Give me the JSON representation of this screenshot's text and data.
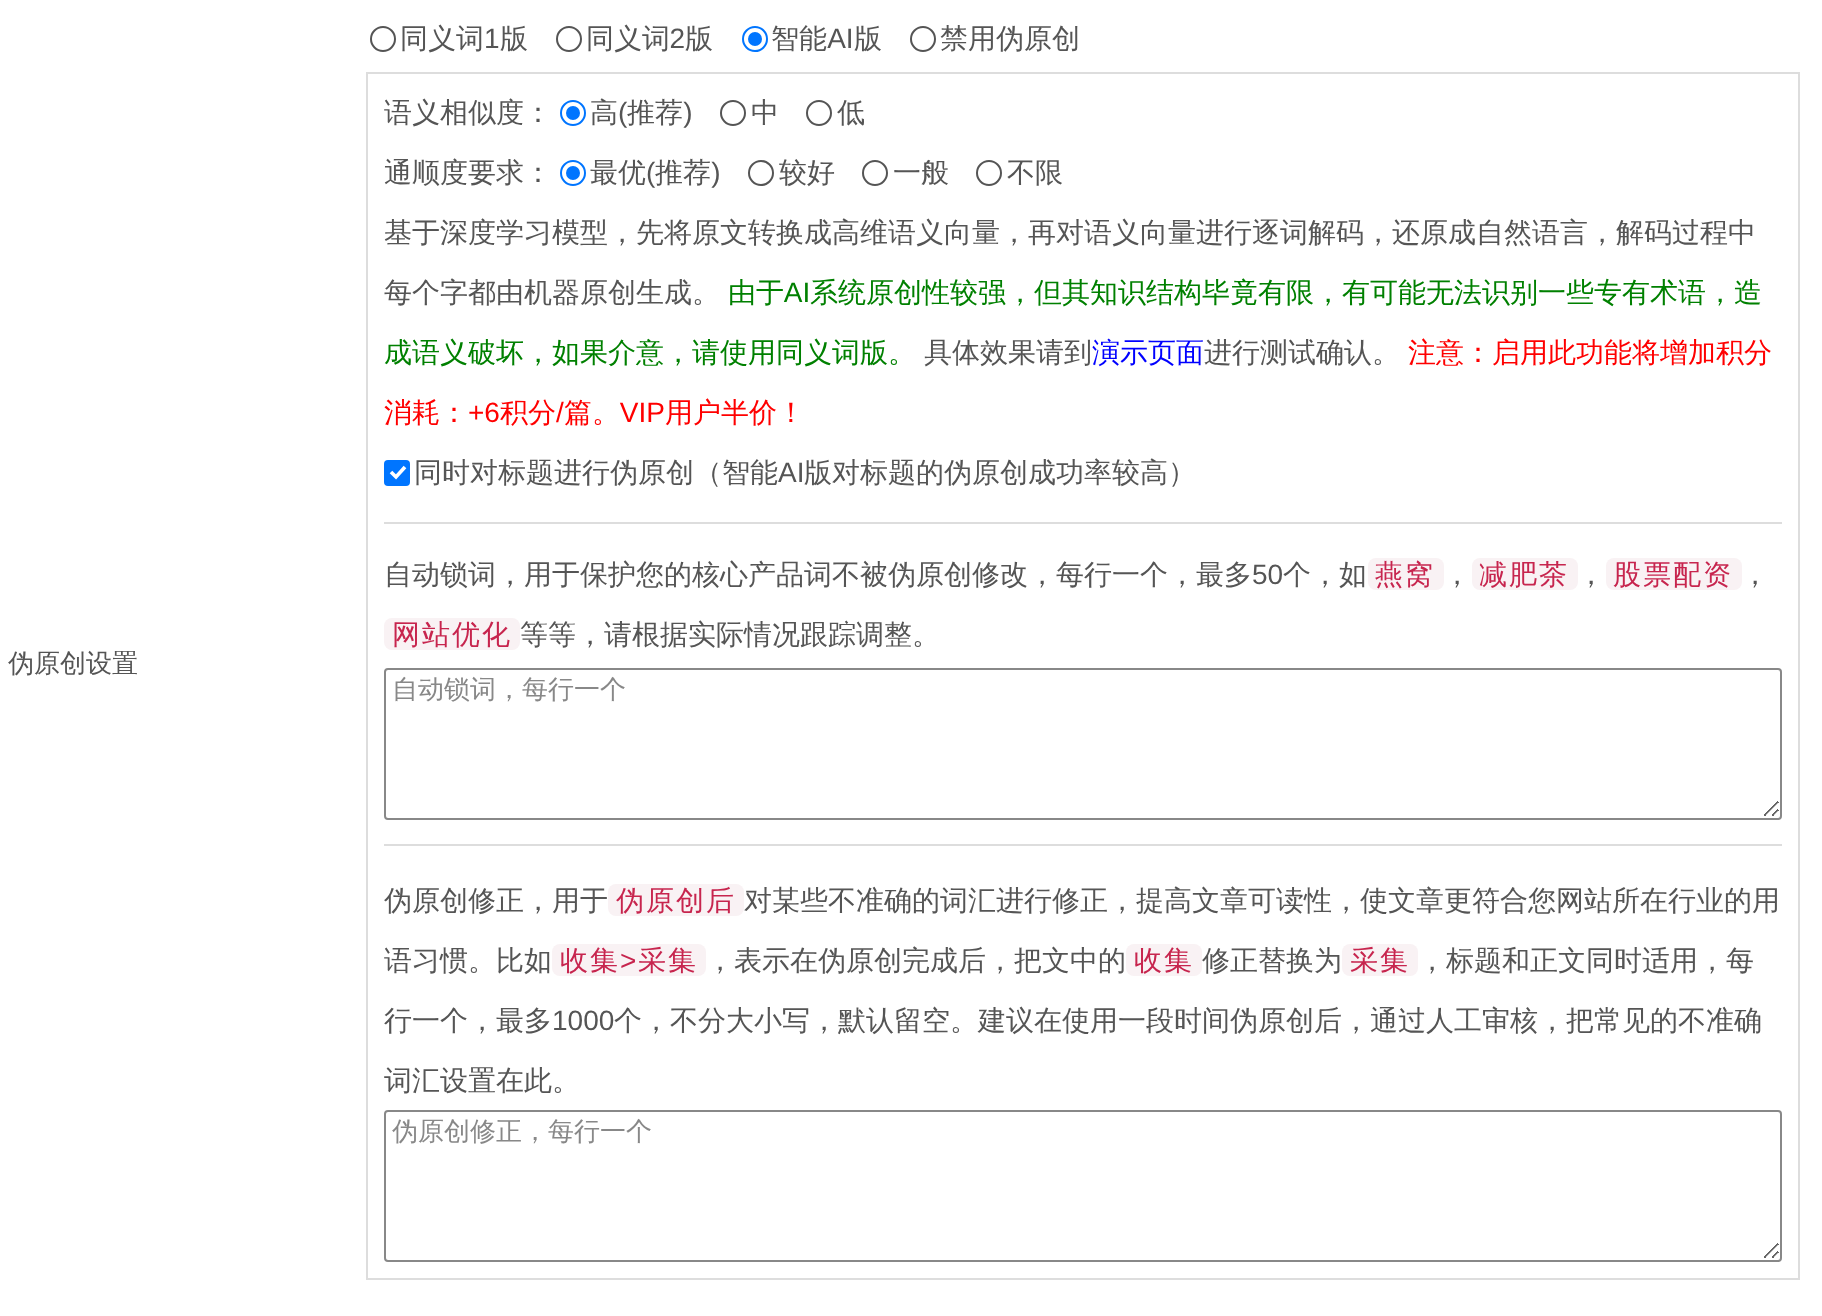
{
  "mode_options": [
    {
      "label": "同义词1版",
      "selected": false
    },
    {
      "label": "同义词2版",
      "selected": false
    },
    {
      "label": "智能AI版",
      "selected": true
    },
    {
      "label": "禁用伪原创",
      "selected": false
    }
  ],
  "side_label": "伪原创设置",
  "similarity": {
    "label": "语义相似度：",
    "options": [
      {
        "label": "高(推荐)",
        "selected": true
      },
      {
        "label": "中",
        "selected": false
      },
      {
        "label": "低",
        "selected": false
      }
    ]
  },
  "fluency": {
    "label": "通顺度要求：",
    "options": [
      {
        "label": "最优(推荐)",
        "selected": true
      },
      {
        "label": "较好",
        "selected": false
      },
      {
        "label": "一般",
        "selected": false
      },
      {
        "label": "不限",
        "selected": false
      }
    ]
  },
  "ai_description": [
    {
      "kind": "plain",
      "text": "基于深度学习模型，先将原文转换成高维语义向量，再对语义向量进行逐词解码，还原成自然语言，解码过程中每个字都由机器原创生成。 "
    },
    {
      "kind": "green",
      "text": "由于AI系统原创性较强，但其知识结构毕竟有限，有可能无法识别一些专有术语，造成语义破坏，如果介意，请使用同义词版。"
    },
    {
      "kind": "plain",
      "text": " 具体效果请到"
    },
    {
      "kind": "link",
      "text": "演示页面"
    },
    {
      "kind": "plain",
      "text": "进行测试确认。 "
    },
    {
      "kind": "red",
      "text": "注意：启用此功能将增加积分消耗：+6积分/篇。VIP用户半价！"
    }
  ],
  "title_option": {
    "label": "同时对标题进行伪原创（智能AI版对标题的伪原创成功率较高）",
    "checked": true
  },
  "lock_words": {
    "description": [
      {
        "kind": "plain",
        "text": "自动锁词，用于保护您的核心产品词不被伪原创修改，每行一个，最多50个，如"
      },
      {
        "kind": "code",
        "text": "燕窝"
      },
      {
        "kind": "plain",
        "text": "，"
      },
      {
        "kind": "code",
        "text": "减肥茶"
      },
      {
        "kind": "plain",
        "text": "，"
      },
      {
        "kind": "code",
        "text": "股票配资"
      },
      {
        "kind": "plain",
        "text": "，"
      },
      {
        "kind": "code",
        "text": "网站优化"
      },
      {
        "kind": "plain",
        "text": "等等，请根据实际情况跟踪调整。"
      }
    ],
    "placeholder": "自动锁词，每行一个"
  },
  "corrections": {
    "description": [
      {
        "kind": "plain",
        "text": "伪原创修正，用于"
      },
      {
        "kind": "code",
        "text": "伪原创后"
      },
      {
        "kind": "plain",
        "text": "对某些不准确的词汇进行修正，提高文章可读性，使文章更符合您网站所在行业的用语习惯。比如"
      },
      {
        "kind": "code",
        "text": "收集>采集"
      },
      {
        "kind": "plain",
        "text": "，表示在伪原创完成后，把文中的"
      },
      {
        "kind": "code",
        "text": "收集"
      },
      {
        "kind": "plain",
        "text": "修正替换为"
      },
      {
        "kind": "code",
        "text": "采集"
      },
      {
        "kind": "plain",
        "text": "，标题和正文同时适用，每行一个，最多1000个，不分大小写，默认留空。建议在使用一段时间伪原创后，通过人工审核，把常见的不准确词汇设置在此。"
      }
    ],
    "placeholder": "伪原创修正，每行一个"
  }
}
